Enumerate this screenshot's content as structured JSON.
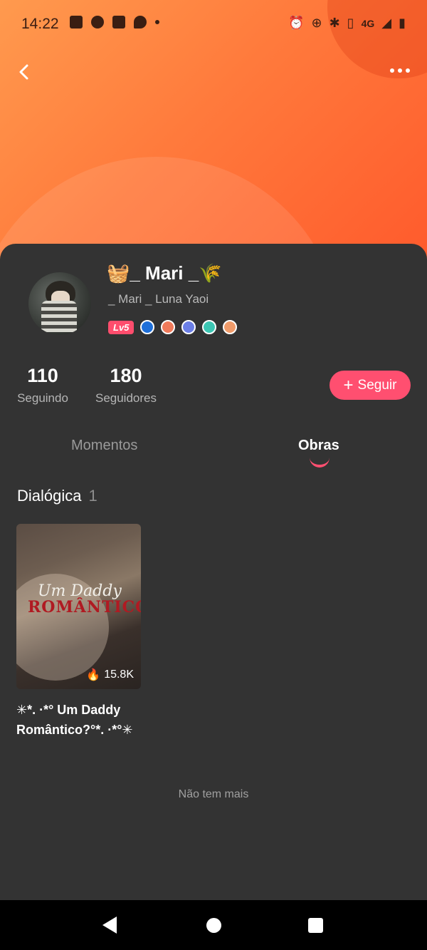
{
  "status_bar": {
    "time": "14:22",
    "network": "4G",
    "left_icons": [
      "facebook-icon",
      "messenger-icon",
      "facebook-icon",
      "chat-icon",
      "dot-icon"
    ],
    "right_icons": [
      "alarm-icon",
      "data-saver-icon",
      "bluetooth-icon",
      "vibrate-icon",
      "signal-icon",
      "battery-icon"
    ]
  },
  "profile": {
    "display_name": "🧺_ Mari _🌾",
    "sub_name": "_ Mari _ Luna Yaoi",
    "level": "Lv5",
    "medal_colors": [
      "#1e6fd9",
      "#f07a5a",
      "#6b7ee6",
      "#3cc6b3",
      "#f09b6a"
    ]
  },
  "stats": {
    "following_count": "110",
    "following_label": "Seguindo",
    "followers_count": "180",
    "followers_label": "Seguidores"
  },
  "follow_button": {
    "label": "Seguir"
  },
  "tabs": {
    "momentos": "Momentos",
    "obras": "Obras",
    "active": "Obras"
  },
  "section": {
    "title": "Dialógica",
    "count": "1"
  },
  "works": [
    {
      "cover_title_line1": "Um Daddy",
      "cover_title_line2": "ROMÂNTICO",
      "views": "15.8K",
      "title": "✳︎*. ·*° Um Daddy Romântico?°*. ·*°✳︎"
    }
  ],
  "footer": {
    "no_more": "Não tem mais"
  },
  "colors": {
    "accent": "#ff4f70",
    "sheet": "#333333",
    "header_gradient_start": "#ff9a4e",
    "header_gradient_end": "#ff5a2c"
  }
}
